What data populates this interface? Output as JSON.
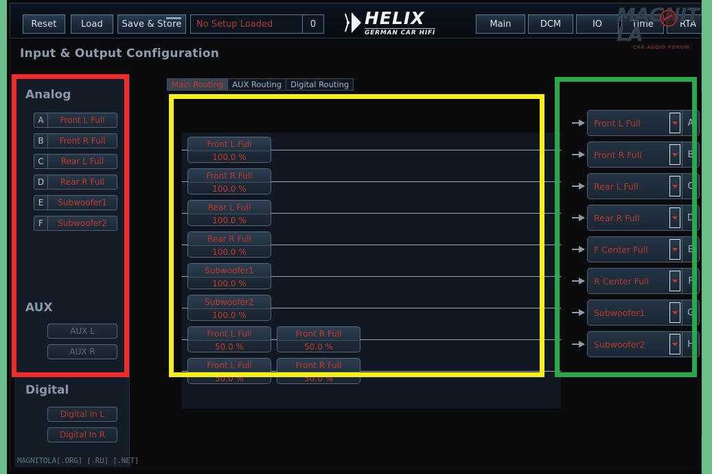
{
  "header": {
    "buttons": {
      "reset": "Reset",
      "load": "Load",
      "save_store": "Save & Store"
    },
    "setup": {
      "name": "No Setup Loaded",
      "number": "0"
    },
    "logo": {
      "main": "HELIX",
      "sub": "GERMAN CAR HIFI"
    },
    "nav": [
      {
        "label": "Main"
      },
      {
        "label": "DCM"
      },
      {
        "label": "IO"
      },
      {
        "label": "Time"
      },
      {
        "label": "RTA"
      }
    ],
    "watermark": {
      "main": "MAGNIT LA",
      "sub": "CAR AUDIO FORUM"
    }
  },
  "page": {
    "title": "Input & Output Configuration",
    "footer_watermark": "MAGNITOLA[.ORG] [.RU] [.NET]"
  },
  "sidebar": {
    "analog_title": "Analog",
    "aux_title": "AUX",
    "digital_title": "Digital",
    "analog": [
      {
        "badge": "A",
        "label": "Front L Full"
      },
      {
        "badge": "B",
        "label": "Front R Full"
      },
      {
        "badge": "C",
        "label": "Rear L Full"
      },
      {
        "badge": "D",
        "label": "Rear R Full"
      },
      {
        "badge": "E",
        "label": "Subwoofer1"
      },
      {
        "badge": "F",
        "label": "Subwoofer2"
      }
    ],
    "aux": [
      {
        "label": "AUX L"
      },
      {
        "label": "AUX R"
      }
    ],
    "digital": [
      {
        "label": "Digital In L"
      },
      {
        "label": "Digital In R"
      }
    ]
  },
  "tabs": [
    {
      "label": "Main Routing",
      "active": true
    },
    {
      "label": "AUX Routing",
      "active": false
    },
    {
      "label": "Digital Routing",
      "active": false
    }
  ],
  "routing": {
    "rows": [
      {
        "cards": [
          {
            "name": "Front L Full",
            "value": "100.0 %"
          }
        ]
      },
      {
        "cards": [
          {
            "name": "Front R Full",
            "value": "100.0 %"
          }
        ]
      },
      {
        "cards": [
          {
            "name": "Rear L Full",
            "value": "100.0 %"
          }
        ]
      },
      {
        "cards": [
          {
            "name": "Rear R Full",
            "value": "100.0 %"
          }
        ]
      },
      {
        "cards": [
          {
            "name": "Subwoofer1",
            "value": "100.0 %"
          }
        ]
      },
      {
        "cards": [
          {
            "name": "Subwoofer2",
            "value": "100.0 %"
          }
        ]
      },
      {
        "cards": [
          {
            "name": "Front L Full",
            "value": "50.0 %"
          },
          {
            "name": "Front R Full",
            "value": "50.0 %"
          }
        ]
      },
      {
        "cards": [
          {
            "name": "Front L Full",
            "value": "50.0 %"
          },
          {
            "name": "Front R Full",
            "value": "50.0 %"
          }
        ]
      }
    ]
  },
  "outputs": [
    {
      "label": "Front L Full",
      "badge": "A"
    },
    {
      "label": "Front R Full",
      "badge": "B"
    },
    {
      "label": "Rear L Full",
      "badge": "C"
    },
    {
      "label": "Rear R Full",
      "badge": "D"
    },
    {
      "label": "F Center Full",
      "badge": "E"
    },
    {
      "label": "R Center Full",
      "badge": "F"
    },
    {
      "label": "Subwoofer1",
      "badge": "G"
    },
    {
      "label": "Subwoofer2",
      "badge": "H"
    }
  ],
  "colors": {
    "accent_red": "#c0392b",
    "frame_red": "#ef2b2b",
    "frame_yellow": "#f7ef19",
    "frame_green": "#29a84c",
    "edge_green": "#6cbf8a"
  }
}
